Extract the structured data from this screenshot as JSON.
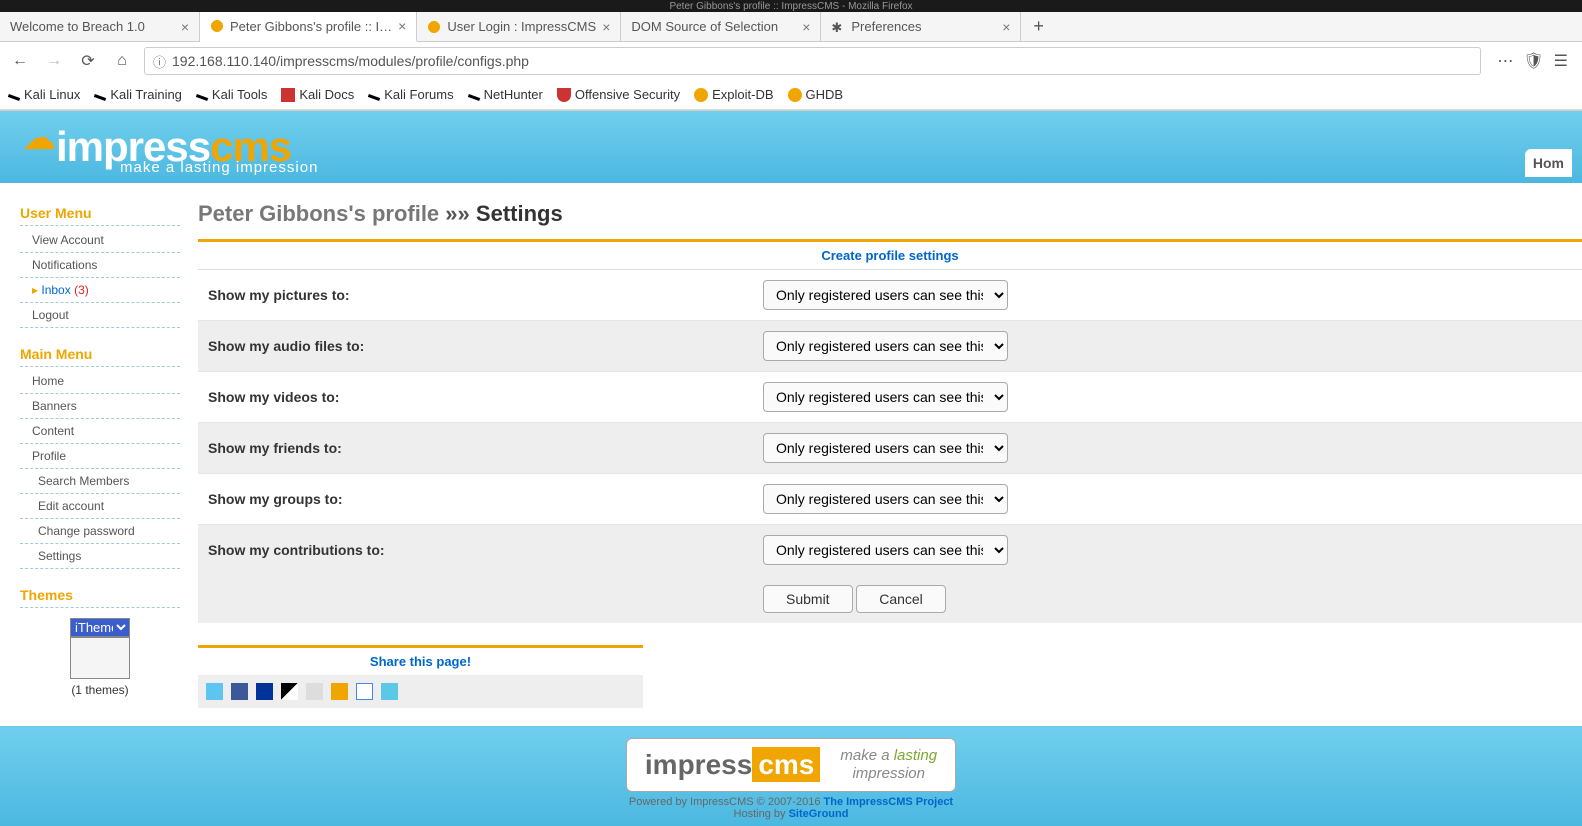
{
  "window_title": "Peter Gibbons's profile :: ImpressCMS - Mozilla Firefox",
  "tabs": [
    {
      "label": "Welcome to Breach 1.0",
      "active": false,
      "favicon": null
    },
    {
      "label": "Peter Gibbons's profile :: I…",
      "active": true,
      "favicon": "orange-chat"
    },
    {
      "label": "User Login : ImpressCMS",
      "active": false,
      "favicon": "orange-chat"
    },
    {
      "label": "DOM Source of Selection",
      "active": false,
      "favicon": null
    },
    {
      "label": "Preferences",
      "active": false,
      "favicon": "gear"
    }
  ],
  "url": "192.168.110.140/impresscms/modules/profile/configs.php",
  "bookmarks": [
    {
      "label": "Kali Linux",
      "icon": "kali"
    },
    {
      "label": "Kali Training",
      "icon": "kali"
    },
    {
      "label": "Kali Tools",
      "icon": "kali"
    },
    {
      "label": "Kali Docs",
      "icon": "red-box"
    },
    {
      "label": "Kali Forums",
      "icon": "kali"
    },
    {
      "label": "NetHunter",
      "icon": "kali"
    },
    {
      "label": "Offensive Security",
      "icon": "red-shield"
    },
    {
      "label": "Exploit-DB",
      "icon": "orange-bug"
    },
    {
      "label": "GHDB",
      "icon": "orange-bug"
    }
  ],
  "logo": {
    "impress": "impress",
    "cms": "cms",
    "tagline": "make a lasting impression"
  },
  "header_nav": {
    "home": "Hom"
  },
  "sidebar": {
    "user_menu_title": "User Menu",
    "user_items": [
      {
        "label": "View Account"
      },
      {
        "label": "Notifications"
      },
      {
        "label": "Inbox",
        "count": "(3)",
        "inbox": true
      },
      {
        "label": "Logout"
      }
    ],
    "main_menu_title": "Main Menu",
    "main_items": [
      {
        "label": "Home"
      },
      {
        "label": "Banners"
      },
      {
        "label": "Content"
      },
      {
        "label": "Profile"
      },
      {
        "label": "Search Members",
        "sub": true
      },
      {
        "label": "Edit account",
        "sub": true
      },
      {
        "label": "Change password",
        "sub": true
      },
      {
        "label": "Settings",
        "sub": true
      }
    ],
    "themes_title": "Themes",
    "theme_selected": "iTheme",
    "theme_count": "(1 themes)"
  },
  "page": {
    "title_prefix": "Peter Gibbons's profile",
    "arrows": "»»",
    "title_suffix": "Settings",
    "create_link": "Create profile settings",
    "rows": [
      {
        "label": "Show my pictures to:",
        "value": "Only registered users can see this"
      },
      {
        "label": "Show my audio files to:",
        "value": "Only registered users can see this"
      },
      {
        "label": "Show my videos to:",
        "value": "Only registered users can see this"
      },
      {
        "label": "Show my friends to:",
        "value": "Only registered users can see this"
      },
      {
        "label": "Show my groups to:",
        "value": "Only registered users can see this"
      },
      {
        "label": "Show my contributions to:",
        "value": "Only registered users can see this"
      }
    ],
    "submit": "Submit",
    "cancel": "Cancel"
  },
  "share": {
    "title": "Share this page!",
    "icons": [
      "twitter",
      "facebook",
      "myspace",
      "delicious",
      "digg",
      "local",
      "google",
      "diigo"
    ]
  },
  "footer": {
    "impress": "impress",
    "cms": "cms",
    "line1a": "make a ",
    "lasting": "lasting",
    "line2": "impression",
    "credits_prefix": "Powered by ImpressCMS © 2007-2016 ",
    "credits_link": "The ImpressCMS Project",
    "hosting_prefix": "Hosting by ",
    "hosting_link": "SiteGround"
  }
}
